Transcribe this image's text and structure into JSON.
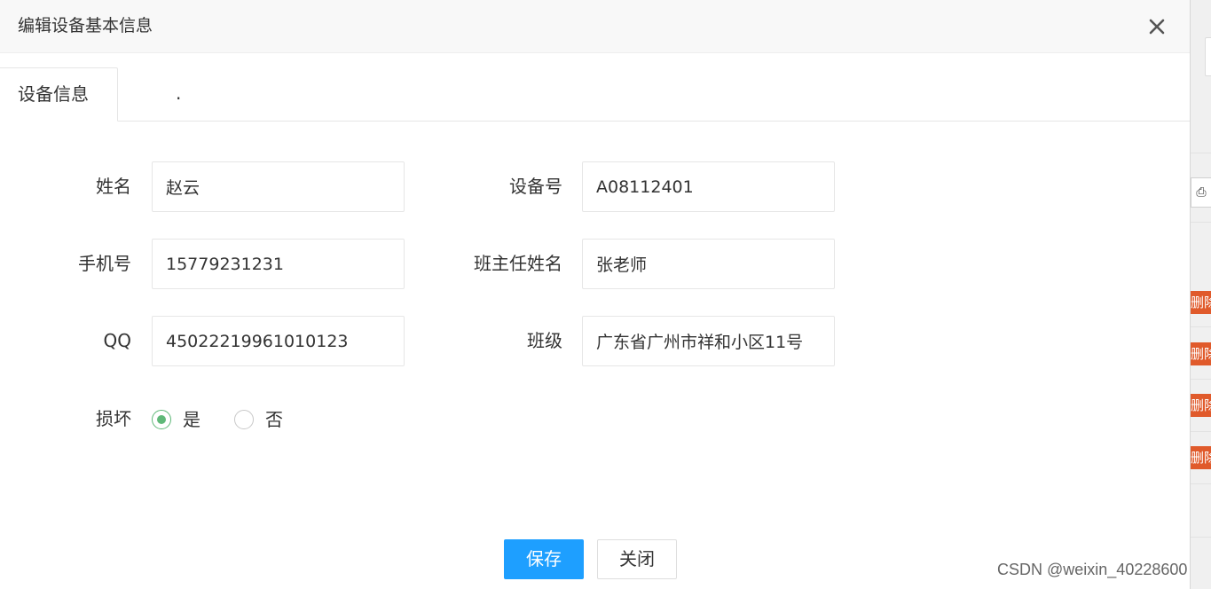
{
  "dialog": {
    "title": "编辑设备基本信息",
    "close_icon": "close-icon"
  },
  "tabs": [
    {
      "label": "设备信息",
      "active": true
    },
    {
      "label": ".",
      "active": false
    }
  ],
  "form": {
    "name_label": "姓名",
    "name_value": "赵云",
    "device_label": "设备号",
    "device_value": "A08112401",
    "phone_label": "手机号",
    "phone_value": "15779231231",
    "teacher_label": "班主任姓名",
    "teacher_value": "张老师",
    "qq_label": "QQ",
    "qq_value": "45022219961010123",
    "class_label": "班级",
    "class_value": "广东省广州市祥和小区11号",
    "damaged_label": "损坏",
    "damaged_options": [
      "是",
      "否"
    ],
    "damaged_selected": "是"
  },
  "buttons": {
    "save_label": "保存",
    "close_label": "关闭"
  },
  "background": {
    "delete_label": "删除",
    "icon": "export-icon"
  },
  "watermark": "CSDN @weixin_40228600",
  "colors": {
    "primary": "#1e9fff",
    "radio_checked": "#5fb878",
    "danger": "#e05a2b"
  }
}
